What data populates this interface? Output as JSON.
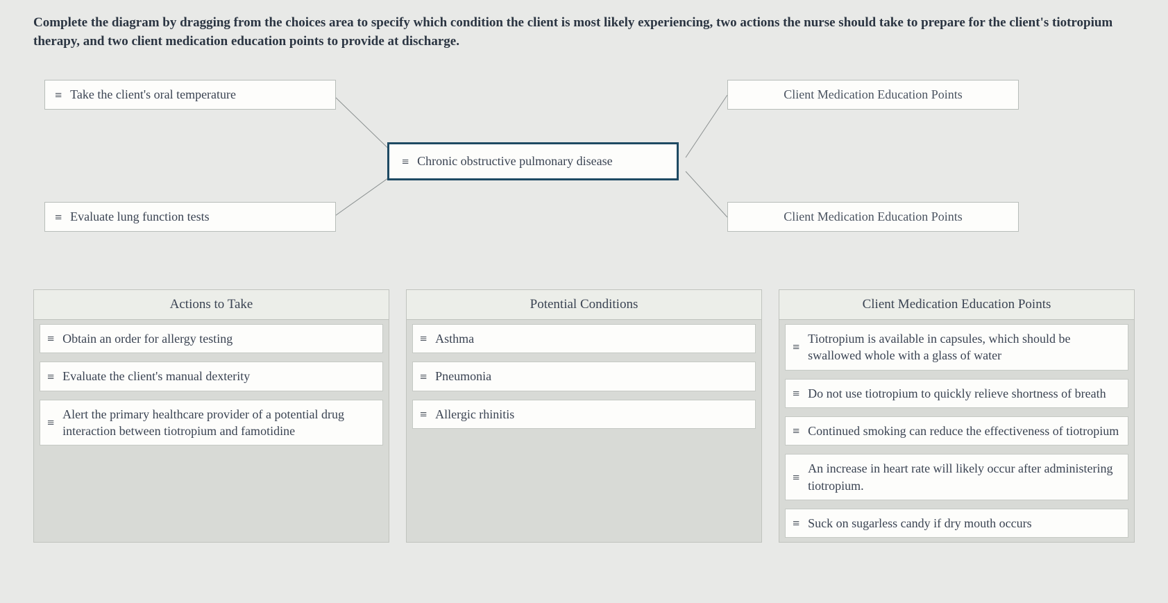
{
  "instructions": "Complete the diagram by dragging from the choices area to specify which condition the client is most likely experiencing, two actions the nurse should take to prepare for the client's tiotropium therapy, and two client medication education points to provide at discharge.",
  "diagram": {
    "action_slot_1": "Take the client's oral temperature",
    "action_slot_2": "Evaluate lung function tests",
    "condition_slot": "Chronic obstructive pulmonary disease",
    "education_slot_1_placeholder": "Client Medication Education Points",
    "education_slot_2_placeholder": "Client Medication Education Points"
  },
  "choices": {
    "actions": {
      "header": "Actions to Take",
      "items": [
        "Obtain an order for allergy testing",
        "Evaluate the client's manual dexterity",
        "Alert the primary healthcare provider of a potential drug interaction between tiotropium and famotidine"
      ]
    },
    "conditions": {
      "header": "Potential Conditions",
      "items": [
        "Asthma",
        "Pneumonia",
        "Allergic rhinitis"
      ]
    },
    "education": {
      "header": "Client Medication Education Points",
      "items": [
        "Tiotropium is available in capsules, which should be swallowed whole with a glass of water",
        "Do not use tiotropium to quickly relieve shortness of breath",
        "Continued smoking can reduce the effectiveness of tiotropium",
        "An increase in heart rate will likely occur after administering tiotropium.",
        "Suck on sugarless candy if dry mouth occurs"
      ]
    }
  }
}
